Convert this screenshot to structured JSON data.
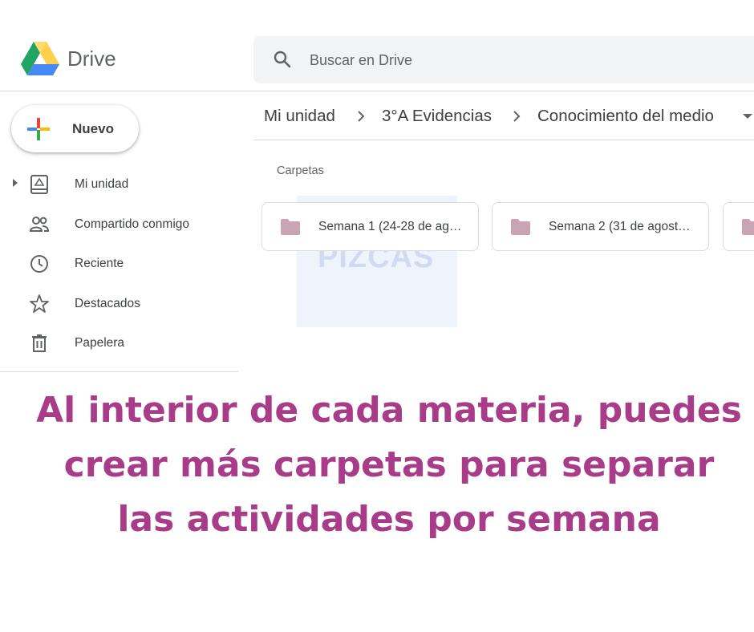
{
  "app": {
    "title": "Drive"
  },
  "search": {
    "placeholder": "Buscar en Drive"
  },
  "new_button": {
    "label": "Nuevo"
  },
  "sidebar": {
    "items": [
      {
        "label": "Mi unidad",
        "icon": "my-drive-icon"
      },
      {
        "label": "Compartido conmigo",
        "icon": "shared-people-icon"
      },
      {
        "label": "Reciente",
        "icon": "clock-icon"
      },
      {
        "label": "Destacados",
        "icon": "star-icon"
      },
      {
        "label": "Papelera",
        "icon": "trash-icon"
      }
    ]
  },
  "breadcrumb": {
    "items": [
      "Mi unidad",
      "3°A Evidencias",
      "Conocimiento del medio"
    ]
  },
  "main": {
    "section_title": "Carpetas",
    "folders": [
      {
        "name": "Semana 1 (24-28 de ag…"
      },
      {
        "name": "Semana 2 (31 de agost…"
      },
      {
        "name": ""
      }
    ]
  },
  "watermark": {
    "text": "PIZCAS"
  },
  "caption": {
    "lines": [
      "Al interior de cada materia, puedes",
      "crear más carpetas para separar",
      "las actividades por semana"
    ]
  },
  "colors": {
    "caption": "#a83c88",
    "folder_icon": "#c9a4b2",
    "drive_green": "#1fa463",
    "drive_yellow": "#ffd04b",
    "drive_blue": "#4688f4"
  }
}
